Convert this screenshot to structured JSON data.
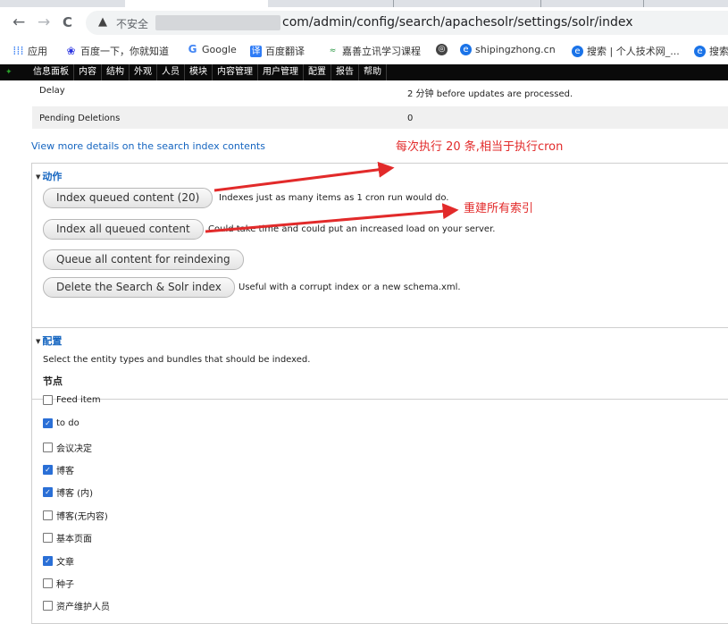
{
  "browser": {
    "nav": {
      "back": "←",
      "forward": "→",
      "reload": "C"
    },
    "security_label": "不安全",
    "url": "com/admin/config/search/apachesolr/settings/solr/index",
    "bookmarks": [
      {
        "label": "应用",
        "icon": "apps-grid-icon",
        "color": "#4285f4"
      },
      {
        "label": "百度一下，你就知道",
        "icon": "baidu-paw-icon",
        "color": "#2932e1"
      },
      {
        "label": "Google",
        "icon": "google-g-icon",
        "color": "#4285f4"
      },
      {
        "label": "百度翻译",
        "icon": "translate-icon",
        "color": "#2f7cf6"
      },
      {
        "label": "嘉善立讯学习课程",
        "icon": "course-icon",
        "color": "#2e9a48"
      },
      {
        "label": "",
        "icon": "globe-icon",
        "color": "#444444"
      },
      {
        "label": "shipingzhong.cn",
        "icon": "edge-blue-icon",
        "color": "#1a73e8"
      },
      {
        "label": "搜索 | 个人技术网_...",
        "icon": "edge-blue-icon",
        "color": "#1a73e8"
      },
      {
        "label": "搜索",
        "icon": "edge-blue-icon",
        "color": "#1a73e8"
      }
    ]
  },
  "admin_toolbar": {
    "items": [
      "信息面板",
      "内容",
      "结构",
      "外观",
      "人员",
      "模块",
      "内容管理",
      "用户管理",
      "配置",
      "报告",
      "帮助"
    ]
  },
  "stats": [
    {
      "label": "Delay",
      "value": "2 分钟 before updates are processed."
    },
    {
      "label": "Pending Deletions",
      "value": "0"
    }
  ],
  "details_link": "View more details on the search index contents",
  "actions": {
    "legend": "动作",
    "buttons": [
      {
        "label": "Index queued content (20)",
        "desc": "Indexes just as many items as 1 cron run would do."
      },
      {
        "label": "Index all queued content",
        "desc": "Could take time and could put an increased load on your server."
      },
      {
        "label": "Queue all content for reindexing",
        "desc": ""
      },
      {
        "label": "Delete the Search & Solr index",
        "desc": "Useful with a corrupt index or a new schema.xml."
      }
    ]
  },
  "config": {
    "legend": "配置",
    "description": "Select the entity types and bundles that should be indexed.",
    "heading": "节点",
    "bundles": [
      {
        "label": "Feed item",
        "checked": false
      },
      {
        "label": "to do",
        "checked": true
      },
      {
        "label": "会议决定",
        "checked": false
      },
      {
        "label": "博客",
        "checked": true
      },
      {
        "label": "博客 (内)",
        "checked": true
      },
      {
        "label": "博客(无内容)",
        "checked": false
      },
      {
        "label": "基本页面",
        "checked": false
      },
      {
        "label": "文章",
        "checked": true
      },
      {
        "label": "种子",
        "checked": false
      },
      {
        "label": "资产维护人员",
        "checked": false
      }
    ]
  },
  "annotations": {
    "note1": "每次执行 20 条,相当于执行cron",
    "note2": "重建所有索引",
    "color": "#e22a2a"
  }
}
